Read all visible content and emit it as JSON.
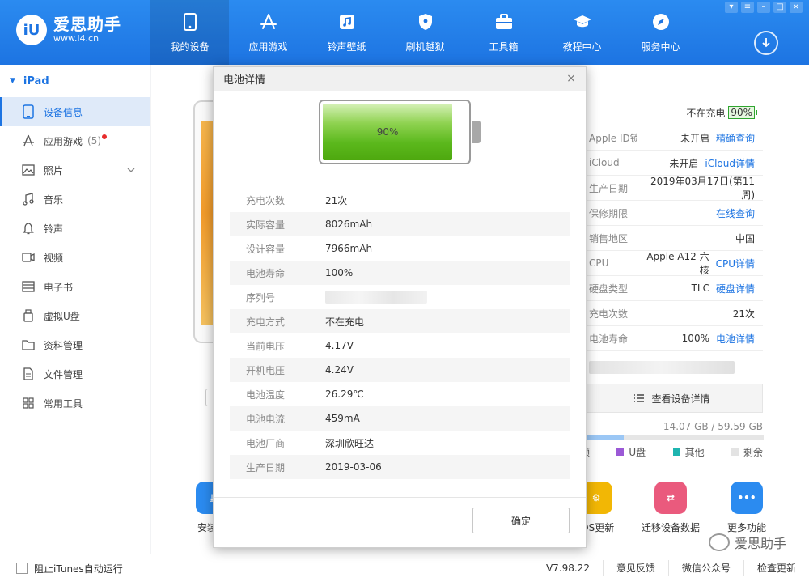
{
  "app": {
    "name": "爱思助手",
    "url": "www.i4.cn",
    "logo_badge": "iU"
  },
  "nav": [
    {
      "label": "我的设备",
      "icon": "phone-icon",
      "active": true
    },
    {
      "label": "应用游戏",
      "icon": "appstore-icon"
    },
    {
      "label": "铃声壁纸",
      "icon": "music-note-icon"
    },
    {
      "label": "刷机越狱",
      "icon": "shield-icon"
    },
    {
      "label": "工具箱",
      "icon": "toolbox-icon"
    },
    {
      "label": "教程中心",
      "icon": "graduation-cap-icon"
    },
    {
      "label": "服务中心",
      "icon": "compass-icon"
    }
  ],
  "sidebar": {
    "device": "iPad",
    "items": [
      {
        "label": "设备信息",
        "icon": "tablet-icon",
        "active": true
      },
      {
        "label": "应用游戏",
        "icon": "appstore-icon",
        "count": "(5)"
      },
      {
        "label": "照片",
        "icon": "image-icon"
      },
      {
        "label": "音乐",
        "icon": "music-note-icon"
      },
      {
        "label": "铃声",
        "icon": "bell-icon"
      },
      {
        "label": "视频",
        "icon": "video-icon"
      },
      {
        "label": "电子书",
        "icon": "book-icon"
      },
      {
        "label": "虚拟U盘",
        "icon": "usb-icon"
      },
      {
        "label": "资料管理",
        "icon": "folder-icon"
      },
      {
        "label": "文件管理",
        "icon": "file-icon"
      },
      {
        "label": "常用工具",
        "icon": "grid-icon"
      }
    ]
  },
  "info": {
    "charge_status": "不在充电",
    "battery_badge": "90%",
    "rows": [
      {
        "label": "Apple ID锁",
        "value": "未开启",
        "link": "精确查询"
      },
      {
        "label": "iCloud",
        "value": "未开启",
        "link": "iCloud详情"
      },
      {
        "label": "生产日期",
        "value": "2019年03月17日(第11周)",
        "link": ""
      },
      {
        "label": "保修期限",
        "value": "",
        "link": "在线查询"
      },
      {
        "label": "销售地区",
        "value": "中国",
        "link": ""
      },
      {
        "label": "CPU",
        "value": "Apple A12 六核",
        "link": "CPU详情"
      },
      {
        "label": "硬盘类型",
        "value": "TLC",
        "link": "硬盘详情"
      },
      {
        "label": "充电次数",
        "value": "21次",
        "link": ""
      },
      {
        "label": "电池寿命",
        "value": "100%",
        "link": "电池详情"
      }
    ],
    "view_details": "查看设备详情",
    "storage": "14.07 GB / 59.59 GB",
    "storage_used_fraction": 0.236
  },
  "legend": [
    {
      "label": "频",
      "color": "#e0e0e0"
    },
    {
      "label": "U盘",
      "color": "#9b59d6"
    },
    {
      "label": "其他",
      "color": "#1fb5b0"
    },
    {
      "label": "剩余",
      "color": "#e3e3e3"
    }
  ],
  "tools": [
    {
      "label": "安装新",
      "icon": "install-icon",
      "color": "#2b8bf0"
    },
    {
      "label": "iOS更新",
      "icon": "gear-icon",
      "color": "#f2b705"
    },
    {
      "label": "迁移设备数据",
      "icon": "migrate-icon",
      "color": "#ea5a7d"
    },
    {
      "label": "更多功能",
      "icon": "more-icon",
      "color": "#2b8bf0"
    }
  ],
  "watermark": "爱思助手",
  "status": {
    "itunes_label": "阻止iTunes自动运行",
    "version": "V7.98.22",
    "feedback": "意见反馈",
    "wechat": "微信公众号",
    "update": "检查更新"
  },
  "modal": {
    "title": "电池详情",
    "battery_level": 0.9,
    "battery_label": "90%",
    "rows": [
      {
        "label": "充电次数",
        "value": "21次"
      },
      {
        "label": "实际容量",
        "value": "8026mAh"
      },
      {
        "label": "设计容量",
        "value": "7966mAh"
      },
      {
        "label": "电池寿命",
        "value": "100%"
      },
      {
        "label": "序列号",
        "value": ""
      },
      {
        "label": "充电方式",
        "value": "不在充电"
      },
      {
        "label": "当前电压",
        "value": "4.17V"
      },
      {
        "label": "开机电压",
        "value": "4.24V"
      },
      {
        "label": "电池温度",
        "value": "26.29℃"
      },
      {
        "label": "电池电流",
        "value": "459mA"
      },
      {
        "label": "电池厂商",
        "value": "深圳欣旺达"
      },
      {
        "label": "生产日期",
        "value": "2019-03-06"
      }
    ],
    "ok": "确定"
  }
}
